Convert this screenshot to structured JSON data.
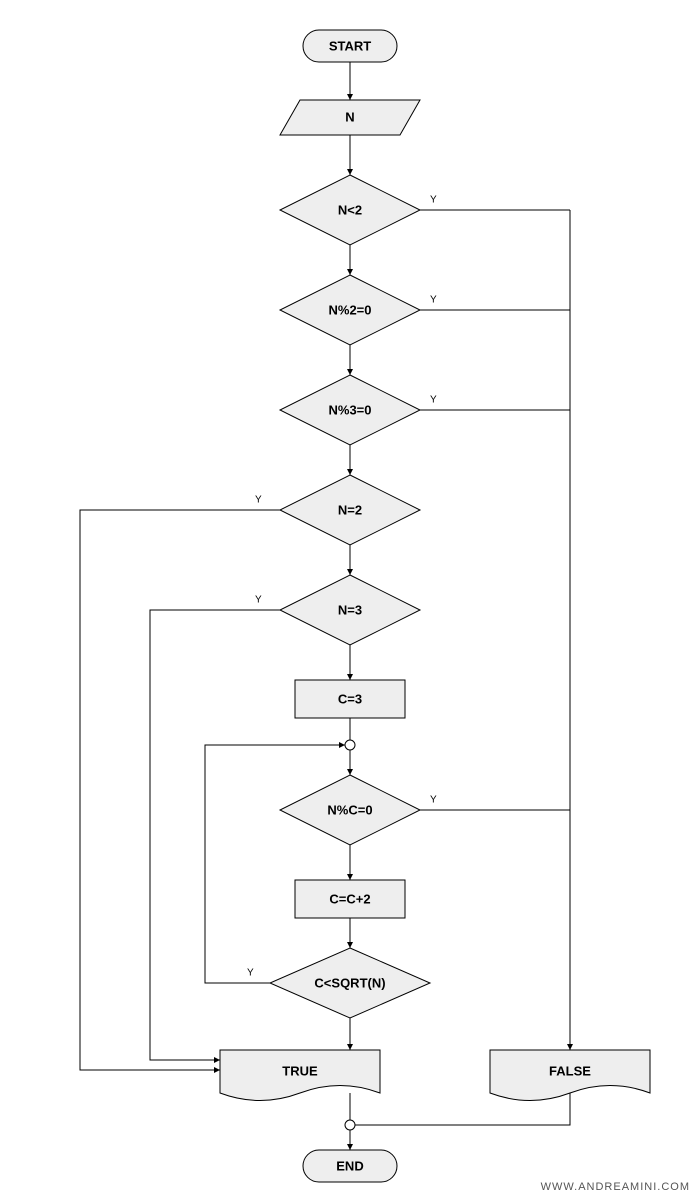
{
  "flowchart": {
    "nodes": {
      "start": "START",
      "input_n": "N",
      "d_n_lt_2": "N<2",
      "d_n_mod_2": "N%2=0",
      "d_n_mod_3": "N%3=0",
      "d_n_eq_2": "N=2",
      "d_n_eq_3": "N=3",
      "p_c3": "C=3",
      "d_n_mod_c": "N%C=0",
      "p_c_inc": "C=C+2",
      "d_c_sqrt": "C<SQRT(N)",
      "out_true": "TRUE",
      "out_false": "FALSE",
      "end": "END"
    },
    "edge_label": "Y",
    "footer": "WWW.ANDREAMINI.COM"
  }
}
